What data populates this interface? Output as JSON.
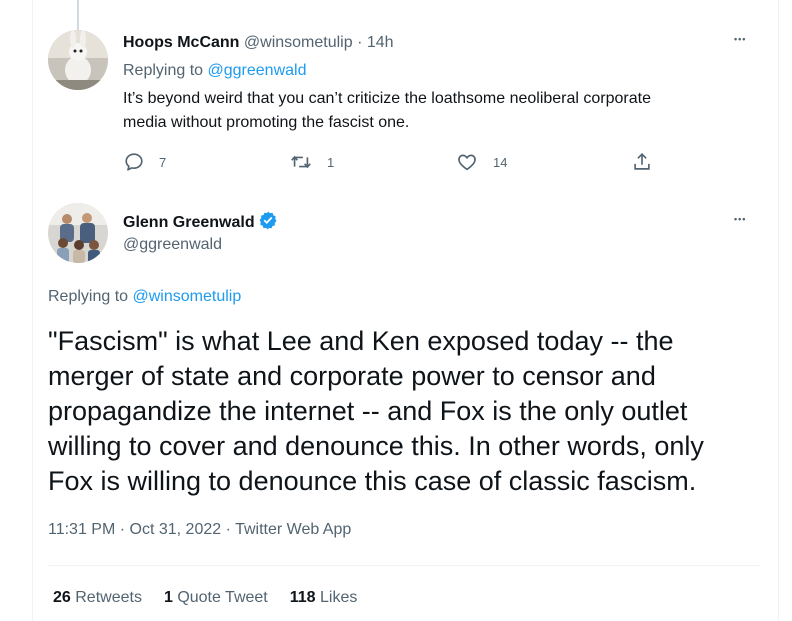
{
  "reply_tweet": {
    "author_name": "Hoops McCann",
    "author_handle": "@winsometulip",
    "separator": "·",
    "time": "14h",
    "replying_prefix": "Replying to ",
    "replying_to": "@ggreenwald",
    "text_line1": "It’s beyond weird that you can’t criticize the loathsome neoliberal corporate",
    "text_line2": "media without promoting the fascist one.",
    "replies": "7",
    "retweets": "1",
    "likes": "14"
  },
  "main_tweet": {
    "author_name": "Glenn Greenwald",
    "author_handle": "@ggreenwald",
    "replying_prefix": "Replying to ",
    "replying_to": "@winsometulip",
    "text_line1": "\"Fascism\" is what Lee and Ken exposed today -- the",
    "text_line2": "merger of state and corporate power to censor and",
    "text_line3": "propagandize the internet -- and Fox is the only outlet",
    "text_line4": "willing to cover and denounce this. In other words, only",
    "text_line5": "Fox is willing to denounce this case of classic fascism.",
    "timestamp": "11:31 PM · Oct 31, 2022 · Twitter Web App",
    "retweets_count": "26",
    "retweets_label": "Retweets",
    "quotes_count": "1",
    "quotes_label": "Quote Tweet",
    "likes_count": "118",
    "likes_label": "Likes"
  },
  "more_glyph": "•••",
  "colors": {
    "accent": "#1d9bf0",
    "muted": "#536471",
    "text": "#0f1419",
    "border": "#eff3f4"
  },
  "icons": [
    "reply-icon",
    "retweet-icon",
    "like-icon",
    "share-icon",
    "verified-badge-icon",
    "more-icon"
  ]
}
